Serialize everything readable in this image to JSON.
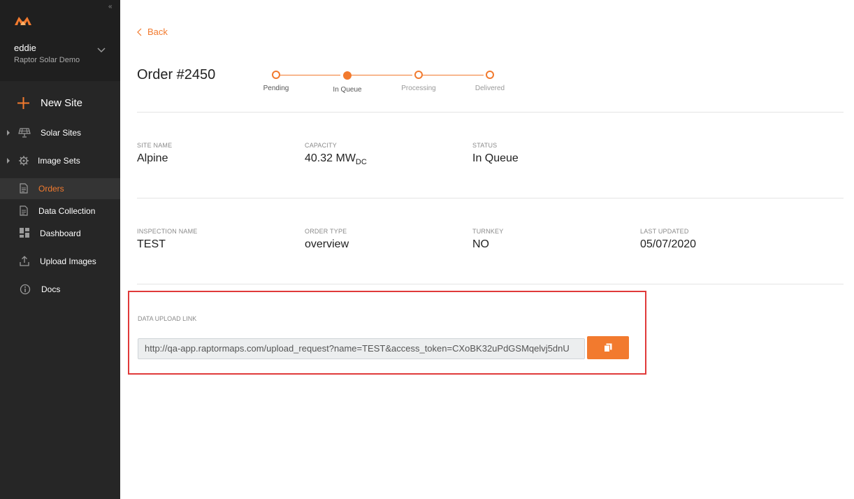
{
  "sidebar": {
    "collapse_glyph": "«",
    "user": {
      "name": "eddie",
      "org": "Raptor Solar Demo"
    },
    "new_site_label": "New Site",
    "items": [
      {
        "label": "Solar Sites",
        "icon": "solar-panel-icon"
      },
      {
        "label": "Image Sets",
        "icon": "gear-icon"
      },
      {
        "label": "Orders",
        "icon": "document-icon",
        "active": true
      },
      {
        "label": "Data Collection",
        "icon": "document-icon"
      },
      {
        "label": "Dashboard",
        "icon": "dashboard-grid-icon"
      },
      {
        "label": "Upload Images",
        "icon": "upload-icon"
      },
      {
        "label": "Docs",
        "icon": "info-icon"
      }
    ]
  },
  "header": {
    "back_label": "Back",
    "order_title": "Order #2450"
  },
  "progress": {
    "steps": [
      "Pending",
      "In Queue",
      "Processing",
      "Delivered"
    ],
    "current": "In Queue"
  },
  "details_row1": {
    "site_name": {
      "label": "SITE NAME",
      "value": "Alpine"
    },
    "capacity": {
      "label": "CAPACITY",
      "value": "40.32 MW",
      "unit_sub": "DC"
    },
    "status": {
      "label": "STATUS",
      "value": "In Queue"
    }
  },
  "details_row2": {
    "inspection_name": {
      "label": "INSPECTION NAME",
      "value": "TEST"
    },
    "order_type": {
      "label": "ORDER TYPE",
      "value": "overview"
    },
    "turnkey": {
      "label": "TURNKEY",
      "value": "NO"
    },
    "last_updated": {
      "label": "LAST UPDATED",
      "value": "05/07/2020"
    }
  },
  "upload": {
    "label": "DATA UPLOAD LINK",
    "link": "http://qa-app.raptormaps.com/upload_request?name=TEST&access_token=CXoBK32uPdGSMqelvj5dnU",
    "copy_icon": "copy-icon"
  },
  "colors": {
    "accent": "#f27a2e",
    "sidebar_bg": "#262626",
    "highlight_border": "#e03a3a"
  }
}
